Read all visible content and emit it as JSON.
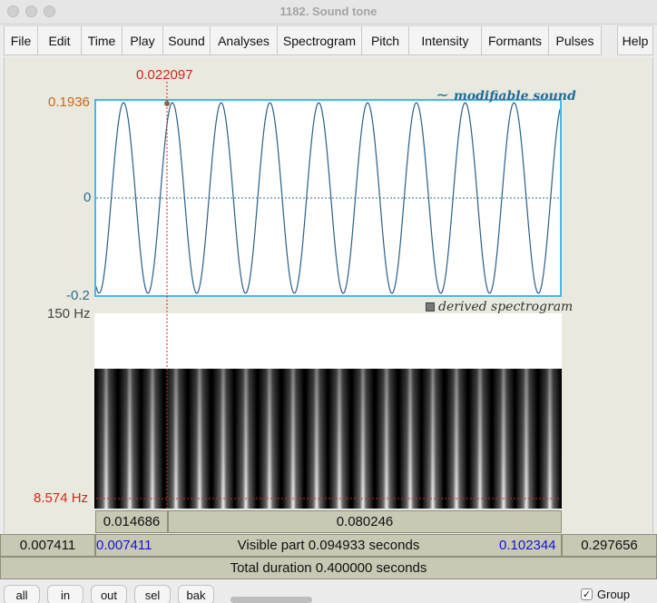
{
  "window": {
    "title": "1182. Sound tone"
  },
  "menu": {
    "items": [
      "File",
      "Edit",
      "Time",
      "Play",
      "Sound",
      "Analyses",
      "Spectrogram",
      "Pitch",
      "Intensity",
      "Formants",
      "Pulses"
    ],
    "help": "Help"
  },
  "cursor": {
    "time": "0.022097"
  },
  "waveform": {
    "amp_top": "0.1936",
    "amp_mid": "0",
    "amp_bottom": "-0.2",
    "label": "modifiable sound",
    "label_icon": "~",
    "line_color": "#2a5f86",
    "frame_color": "#46b8e6",
    "cycles_visible": 9.5,
    "cursor_marker_value": 0.1936
  },
  "spectrogram": {
    "label": "derived spectrogram",
    "freq_top": "150 Hz",
    "freq_cursor": "8.574 Hz",
    "stripes": 20
  },
  "selection_row": {
    "left_segment": "0.014686",
    "right_segment": "0.080246"
  },
  "visible_row": {
    "left_outside": "0.007411",
    "window_start": "0.007411",
    "caption": "Visible part 0.094933 seconds",
    "window_end": "0.102344",
    "right_outside": "0.297656"
  },
  "total_row": {
    "caption": "Total duration 0.400000 seconds"
  },
  "buttons": {
    "all": "all",
    "in": "in",
    "out": "out",
    "sel": "sel",
    "bak": "bak"
  },
  "group": {
    "checked": true,
    "check_glyph": "✓",
    "label": "Group"
  }
}
